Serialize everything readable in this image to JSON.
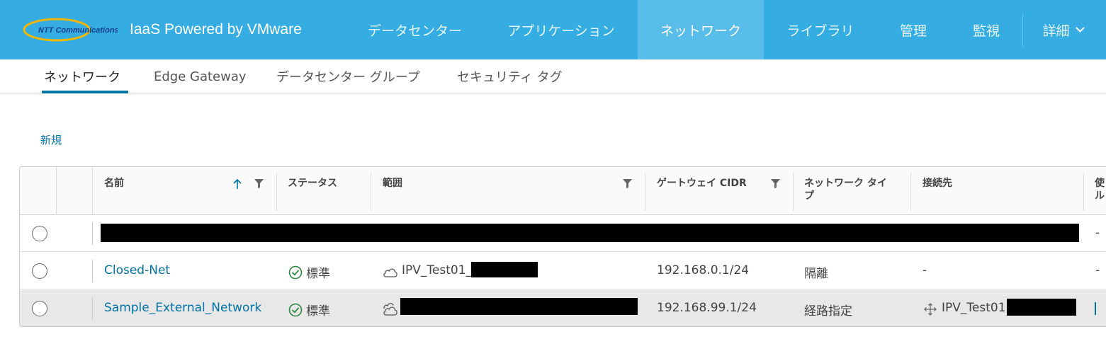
{
  "header": {
    "logo_text": "NTT Communications",
    "app_title": "IaaS Powered by VMware",
    "nav": [
      {
        "label": "データセンター",
        "active": false
      },
      {
        "label": "アプリケーション",
        "active": false
      },
      {
        "label": "ネットワーク",
        "active": true
      },
      {
        "label": "ライブラリ",
        "active": false
      },
      {
        "label": "管理",
        "active": false
      },
      {
        "label": "監視",
        "active": false
      },
      {
        "label": "詳細",
        "active": false
      }
    ]
  },
  "subnav": {
    "tabs": [
      {
        "label": "ネットワーク",
        "active": true
      },
      {
        "label": "Edge Gateway",
        "active": false
      },
      {
        "label": "データセンター グループ",
        "active": false
      },
      {
        "label": "セキュリティ タグ",
        "active": false
      }
    ]
  },
  "actions": {
    "new_label": "新規"
  },
  "grid": {
    "columns": {
      "name": "名前",
      "status": "ステータス",
      "scope": "範囲",
      "gateway_cidr": "ゲートウェイ CIDR",
      "network_type_1": "ネットワーク タイ",
      "network_type_2": "プ",
      "connected_to": "接続先",
      "extra_1": "使",
      "extra_2": "ル"
    },
    "rows": [
      {
        "name": "",
        "status": "",
        "scope": "",
        "cidr": "",
        "type": "",
        "connected": "",
        "extra": "-"
      },
      {
        "name": "Closed-Net",
        "status": "標準",
        "scope": "IPV_Test01_",
        "cidr": "192.168.0.1/24",
        "type": "隔離",
        "connected": "-",
        "extra": "-"
      },
      {
        "name": "Sample_External_Network",
        "status": "標準",
        "scope": "",
        "cidr": "192.168.99.1/24",
        "type": "経路指定",
        "connected": "IPV_Test01",
        "extra": ""
      }
    ]
  },
  "colors": {
    "header_bg": "#35ade2",
    "nav_active_bg": "#58bde8",
    "link_blue": "#0072a3",
    "status_green": "#2e8540"
  },
  "icons": {
    "sort": "arrow-up-icon",
    "filter": "filter-icon",
    "status_ok": "check-circle-icon",
    "scope_cloud": "cloud-icon",
    "scope_multicloud": "multi-cloud-icon",
    "connection": "move-arrows-icon"
  }
}
